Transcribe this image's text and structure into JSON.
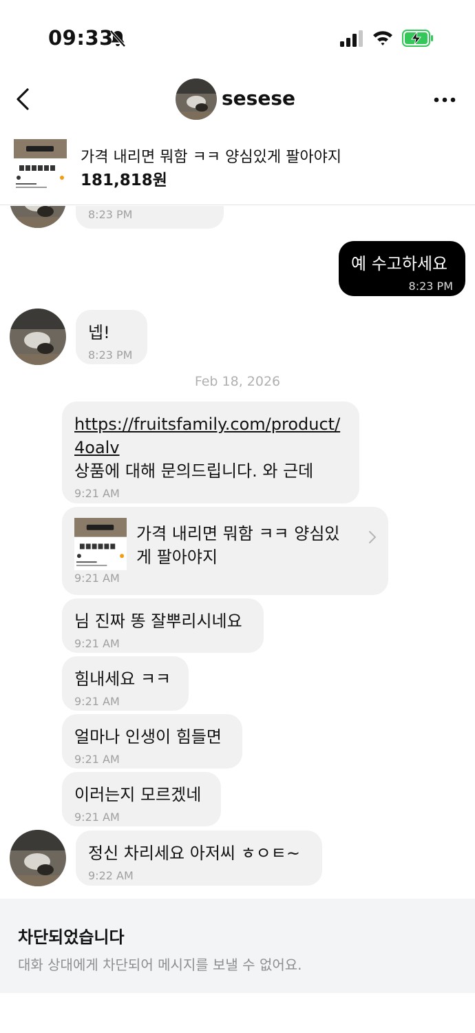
{
  "status_bar": {
    "time": "09:33"
  },
  "header": {
    "name": "sesese"
  },
  "product": {
    "title": "가격 내리면 뭐함 ㅋㅋ 양심있게 팔아야지",
    "price": "181,818원"
  },
  "messages": [
    {
      "side": "theirs",
      "text": "",
      "time": "8:23 PM"
    },
    {
      "side": "mine",
      "text": "예 수고하세요",
      "time": "8:23 PM"
    },
    {
      "side": "theirs",
      "text": "넵!",
      "time": "8:23 PM"
    },
    {
      "date_separator": "Feb 18, 2026"
    },
    {
      "side": "sent-gray",
      "link": "https://fruitsfamily.com/product/\n4oalv",
      "text": "상품에 대해 문의드립니다. 와 근데",
      "time": "9:21 AM"
    },
    {
      "side": "sent-gray",
      "card_title": "가격 내리면 뭐함 ㅋㅋ 양심있\n게 팔아야지",
      "time": "9:21 AM"
    },
    {
      "side": "sent-gray",
      "text": "님 진짜 똥 잘뿌리시네요",
      "time": "9:21 AM"
    },
    {
      "side": "sent-gray",
      "text": "힘내세요 ㅋㅋ",
      "time": "9:21 AM"
    },
    {
      "side": "sent-gray",
      "text": "얼마나 인생이 힘들면",
      "time": "9:21 AM"
    },
    {
      "side": "sent-gray",
      "text": "이러는지 모르겠네",
      "time": "9:21 AM"
    },
    {
      "side": "theirs",
      "text": "정신 차리세요 아저씨 ㅎㅇㅌ~",
      "time": "9:22 AM"
    }
  ],
  "blocked": {
    "title": "차단되었습니다",
    "description": "대화 상대에게 차단되어 메시지를 보낼 수 없어요."
  },
  "colors": {
    "mine_bubble": "#000000",
    "other_bubble": "#f1f1f1",
    "battery_green": "#34c759"
  },
  "icons": [
    "back-icon",
    "more-icon",
    "bell-off-icon",
    "signal-icon",
    "wifi-icon",
    "battery-charging-icon",
    "chevron-right-icon"
  ]
}
